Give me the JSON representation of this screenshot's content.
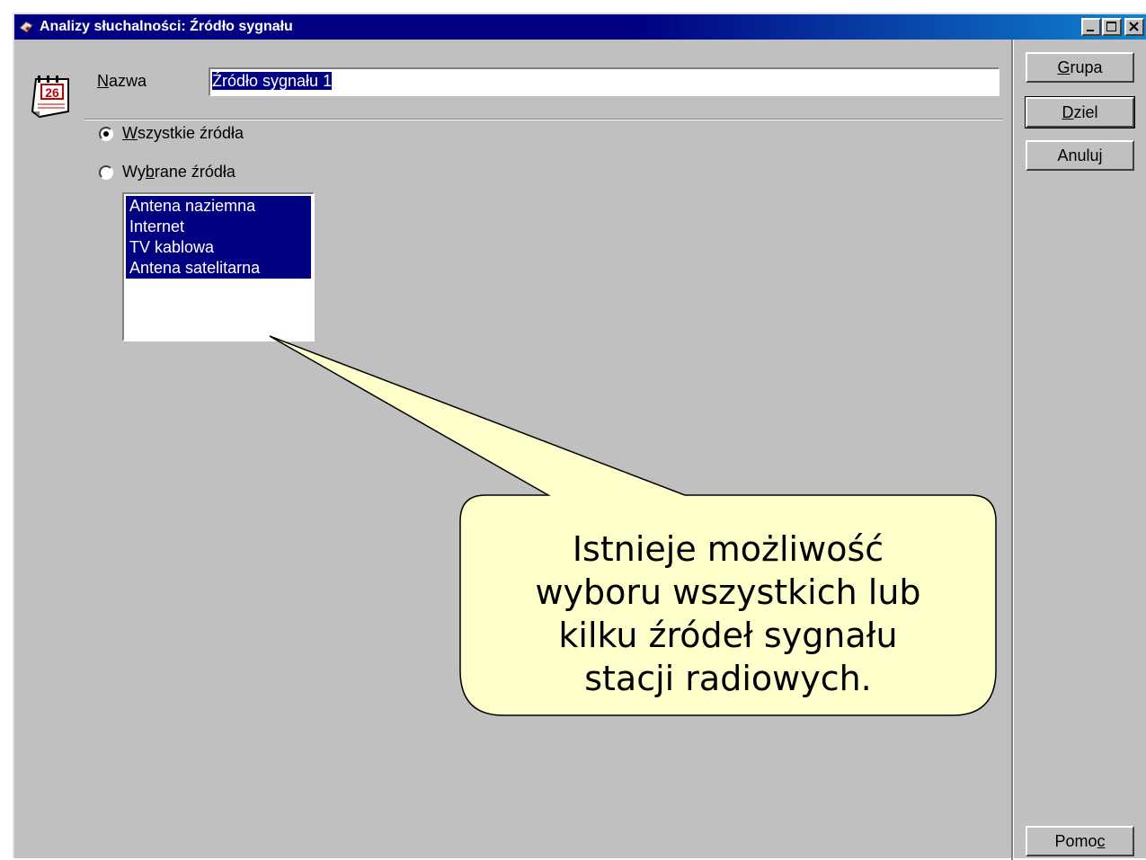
{
  "window": {
    "title": "Analizy słuchalności: Źródło sygnału",
    "controls": [
      "minimize",
      "maximize",
      "close"
    ]
  },
  "form": {
    "name_label": "Nazwa",
    "name_value": "Źródło sygnału 1",
    "radio_all_label": "Wszystkie źródła",
    "radio_selected_label": "Wybrane źródła",
    "radio_checked": "all",
    "sources": [
      "Antena naziemna",
      "Internet",
      "TV kablowa",
      "Antena satelitarna"
    ]
  },
  "buttons": {
    "grupa": "Grupa",
    "dziel": "Dziel",
    "anuluj": "Anuluj",
    "pomoc": "Pomoc"
  },
  "callout": {
    "lines": [
      "Istnieje możliwość",
      "wyboru wszystkich lub",
      "kilku źródeł sygnału",
      "stacji radiowych."
    ]
  },
  "icons": {
    "title": "app-icon",
    "form": "calendar-icon"
  }
}
